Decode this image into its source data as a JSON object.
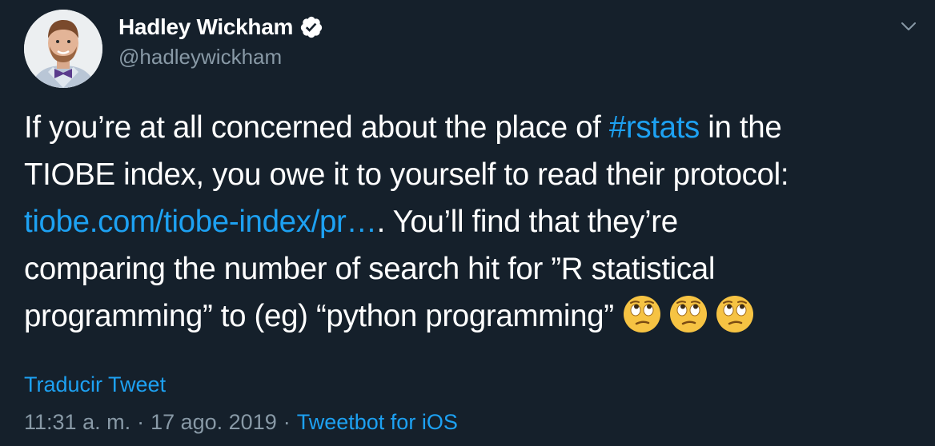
{
  "author": {
    "display_name": "Hadley Wickham",
    "handle": "@hadleywickham",
    "verified": true
  },
  "tweet": {
    "line1_a": "If you’re at all concerned about the place of ",
    "hashtag": "#rstats",
    "line1_b": " in the",
    "line2": "TIOBE index, you owe it to yourself to read their protocol:",
    "link": "tiobe.com/tiobe-index/pr…",
    "line3_b": ". You’ll find that they’re",
    "line4": "comparing the number of search hit for ”R statistical",
    "line5": "programming” to (eg) “python programming”",
    "emojis": [
      "face-with-rolling-eyes",
      "face-with-rolling-eyes",
      "face-with-rolling-eyes"
    ]
  },
  "actions": {
    "translate_label": "Traducir Tweet"
  },
  "meta": {
    "time": "11:31 a. m.",
    "separator": "·",
    "date": "17 ago. 2019",
    "source": "Tweetbot for iOS"
  },
  "colors": {
    "background": "#15202b",
    "accent": "#1da1f2",
    "muted": "#8899a6",
    "text": "#ffffff"
  },
  "icons": {
    "verified": "verified-badge-icon",
    "menu": "chevron-down-icon"
  }
}
